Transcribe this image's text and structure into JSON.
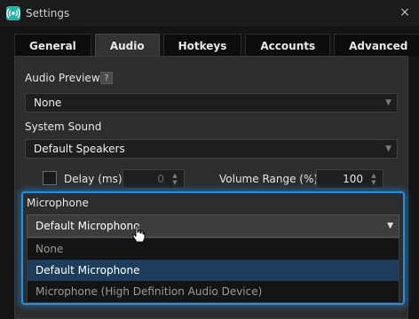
{
  "window": {
    "title": "Settings",
    "close_glyph": "×",
    "app_icon": "broadcast-icon"
  },
  "tabs": [
    {
      "label": "General",
      "active": false
    },
    {
      "label": "Audio",
      "active": true
    },
    {
      "label": "Hotkeys",
      "active": false
    },
    {
      "label": "Accounts",
      "active": false
    },
    {
      "label": "Advanced",
      "active": false
    }
  ],
  "audio_preview": {
    "label": "Audio Preview",
    "help": "?",
    "value": "None"
  },
  "system_sound": {
    "label": "System Sound",
    "value": "Default Speakers"
  },
  "delay": {
    "label": "Delay (ms)",
    "value": "0",
    "checked": false
  },
  "volume_range": {
    "label": "Volume Range (%)",
    "value": "100"
  },
  "microphone": {
    "label": "Microphone",
    "value": "Default Microphone",
    "options": [
      "None",
      "Default Microphone",
      "Microphone (High Definition Audio Device)"
    ],
    "selected_index": 1
  },
  "colors": {
    "focus": "#1e90e6",
    "selected_option": "#1e3d5c",
    "panel": "#2d2d2d"
  }
}
